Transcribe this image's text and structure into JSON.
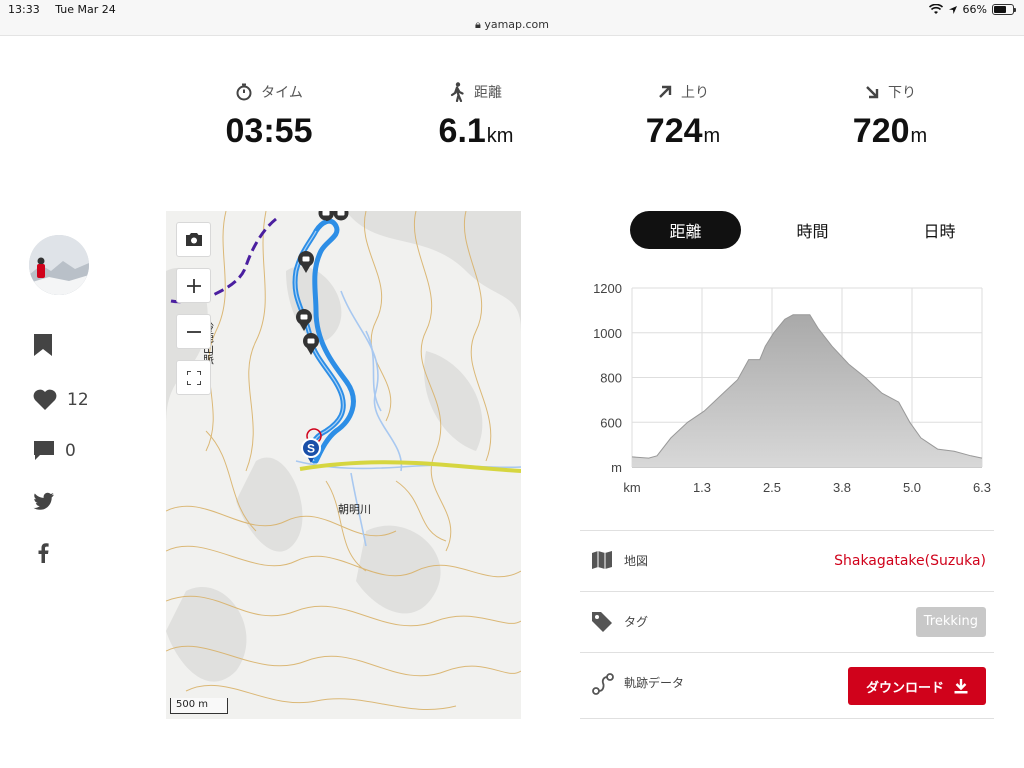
{
  "status_bar": {
    "time": "13:33",
    "date": "Tue Mar 24",
    "url": "yamap.com",
    "battery": "66%",
    "battery_level": 0.66
  },
  "stats": [
    {
      "label": "タイム",
      "value": "03:55",
      "unit": "",
      "icon": "stopwatch-icon"
    },
    {
      "label": "距離",
      "value": "6.1",
      "unit": "km",
      "icon": "walking-icon"
    },
    {
      "label": "上り",
      "value": "724",
      "unit": "m",
      "icon": "arrow-up-right-icon"
    },
    {
      "label": "下り",
      "value": "720",
      "unit": "m",
      "icon": "arrow-down-right-icon"
    }
  ],
  "sidebar": {
    "likes": "12",
    "comments": "0"
  },
  "map": {
    "labels": {
      "river": "朝明川",
      "range": "鈴鹿山脈"
    },
    "scale": "500 m",
    "start_marker": "S"
  },
  "tabs": [
    "距離",
    "時間",
    "日時"
  ],
  "active_tab": 0,
  "chart_data": {
    "type": "area",
    "x_tick_labels": [
      "km",
      "1.3",
      "2.5",
      "3.8",
      "5.0",
      "6.3"
    ],
    "y_tick_labels": [
      "m",
      "600",
      "800",
      "1000",
      "1200"
    ],
    "ylim": [
      400,
      1200
    ],
    "xlim": [
      0,
      6.3
    ],
    "x": [
      0,
      0.3,
      0.45,
      0.7,
      1.0,
      1.3,
      1.6,
      1.9,
      2.1,
      2.3,
      2.4,
      2.55,
      2.75,
      2.9,
      3.05,
      3.2,
      3.35,
      3.6,
      3.9,
      4.2,
      4.5,
      4.8,
      5.0,
      5.2,
      5.5,
      5.8,
      6.1,
      6.3
    ],
    "y": [
      445,
      440,
      450,
      530,
      600,
      650,
      720,
      790,
      880,
      880,
      940,
      1000,
      1060,
      1080,
      1080,
      1080,
      1020,
      940,
      860,
      800,
      730,
      690,
      600,
      530,
      480,
      470,
      450,
      440
    ],
    "color": "#aaaaaa"
  },
  "info": {
    "map_label": "地図",
    "map_value": "Shakagatake(Suzuka)",
    "tag_label": "タグ",
    "tag_value": "Trekking",
    "track_label": "軌跡データ",
    "download_label": "ダウンロード"
  },
  "colors": {
    "accent": "#d0021b",
    "route": "#2d8ee6",
    "active_tab": "#111111"
  }
}
